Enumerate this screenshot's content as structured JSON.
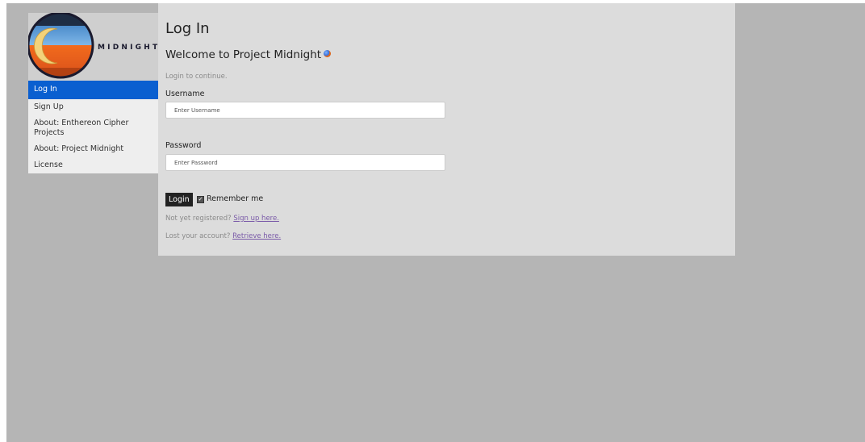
{
  "sidebar": {
    "logo_text": "MIDNIGHT",
    "items": [
      {
        "label": "Log In",
        "active": true
      },
      {
        "label": "Sign Up",
        "active": false
      },
      {
        "label": "About: Enthereon Cipher Projects",
        "active": false
      },
      {
        "label": "About: Project Midnight",
        "active": false
      },
      {
        "label": "License",
        "active": false
      }
    ]
  },
  "main": {
    "title": "Log In",
    "welcome": "Welcome to Project Midnight",
    "welcome_icon": "globe-icon",
    "subtitle": "Login to continue.",
    "username": {
      "label": "Username",
      "placeholder": "Enter Username",
      "value": ""
    },
    "password": {
      "label": "Password",
      "placeholder": "Enter Password",
      "value": ""
    },
    "login_button": "Login",
    "remember_me": {
      "label": "Remember me",
      "checked": true
    },
    "register_prompt": "Not yet registered?",
    "register_link": "Sign up here.",
    "recover_prompt": "Lost your account?",
    "recover_link": "Retrieve here."
  },
  "colors": {
    "accent": "#0a5fd0",
    "page_background": "#b5b5b5",
    "panel_background": "#dcdcdc",
    "button": "#222222",
    "link": "#7a5aa8"
  }
}
